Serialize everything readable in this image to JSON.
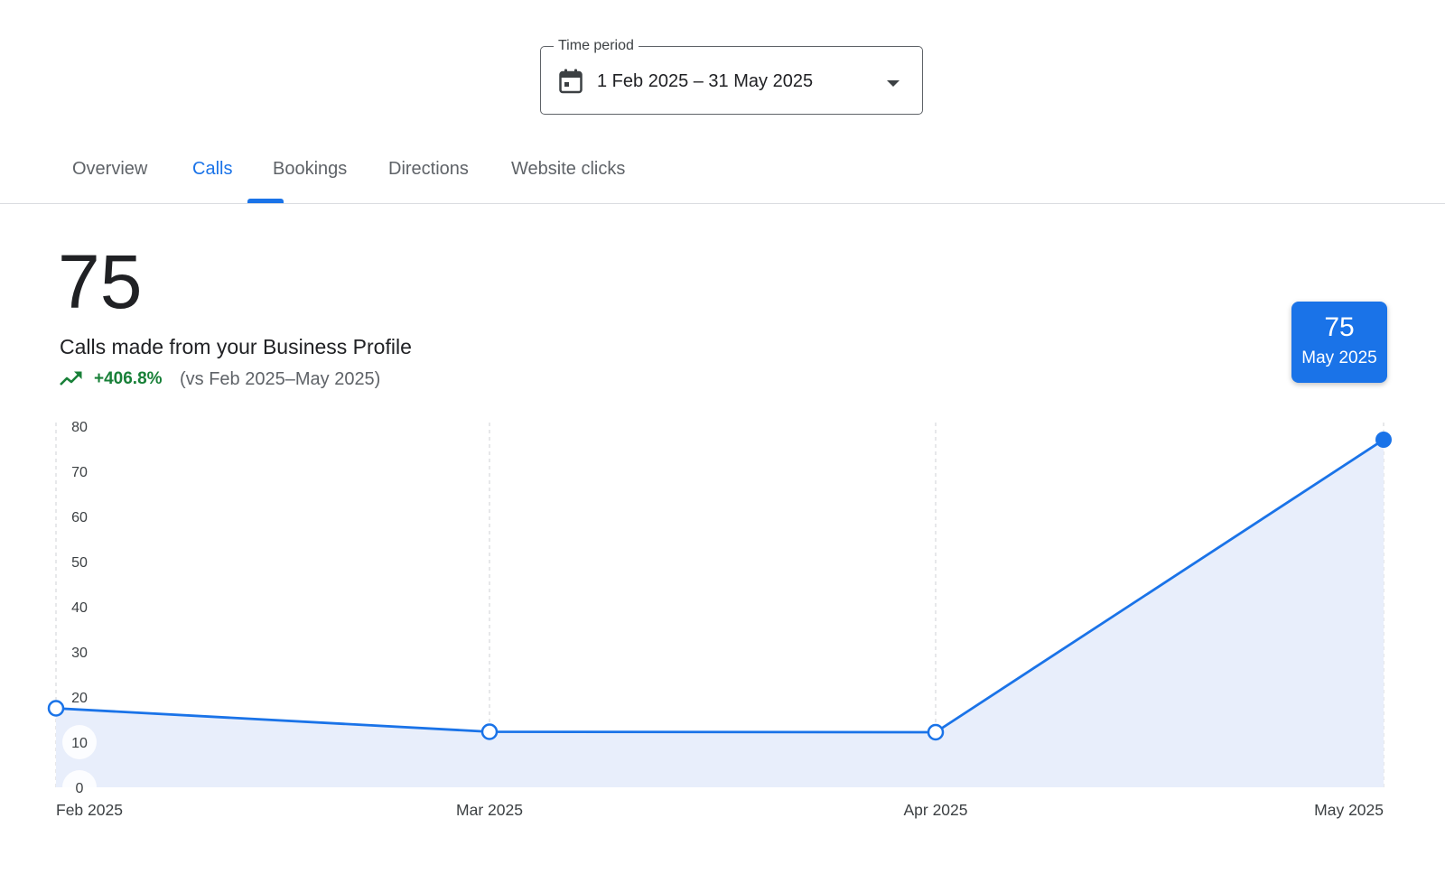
{
  "time_period": {
    "label": "Time period",
    "value": "1 Feb 2025 – 31 May 2025",
    "icon": "calendar-icon"
  },
  "tabs": [
    {
      "label": "Overview",
      "active": false
    },
    {
      "label": "Calls",
      "active": true
    },
    {
      "label": "Bookings",
      "active": false
    },
    {
      "label": "Directions",
      "active": false
    },
    {
      "label": "Website clicks",
      "active": false
    }
  ],
  "metric": {
    "value": "75",
    "label": "Calls made from your Business Profile",
    "change": "+406.8%",
    "compare": "(vs Feb 2025–May 2025)",
    "trend_icon": "trending-up-icon"
  },
  "tooltip": {
    "value": "75",
    "date": "May 2025"
  },
  "colors": {
    "accent": "#1a73e8",
    "positive": "#188038",
    "area_fill": "#e8eefb"
  },
  "chart_data": {
    "type": "area",
    "x": [
      "Feb 2025",
      "Mar 2025",
      "Apr 2025",
      "May 2025"
    ],
    "series": [
      {
        "values": [
          17.5,
          12.3,
          12.2,
          77
        ]
      }
    ],
    "yticks": [
      0,
      10,
      20,
      30,
      40,
      50,
      60,
      70,
      80
    ],
    "ylim": [
      0,
      80
    ],
    "highlighted_point": "May 2025",
    "grid": "vertical-dashed"
  }
}
